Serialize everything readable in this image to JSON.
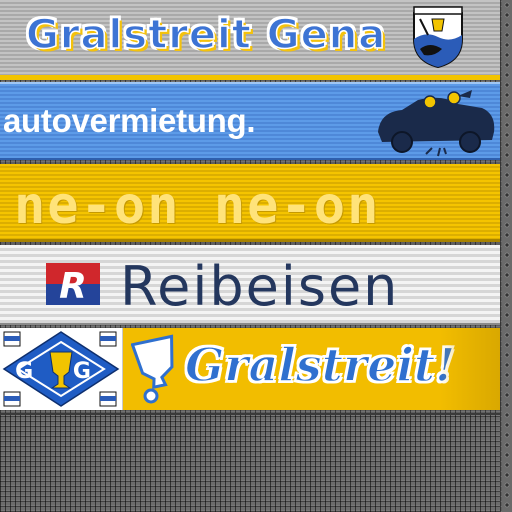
{
  "banners": {
    "gralstreit_gena": {
      "title": "Gralstreit Gena"
    },
    "autovermietung": {
      "text": "autovermietung."
    },
    "neon": {
      "text": "ne-on ne-on"
    },
    "reibeisen": {
      "text": "Reibeisen",
      "logo_letter": "R"
    },
    "gralstreit": {
      "text": "Gralstreit!",
      "badge_letters": "G G"
    }
  },
  "colors": {
    "blue": "#3d74d4",
    "yellow": "#f2bd00",
    "navy": "#24375e",
    "red": "#d0272c"
  }
}
